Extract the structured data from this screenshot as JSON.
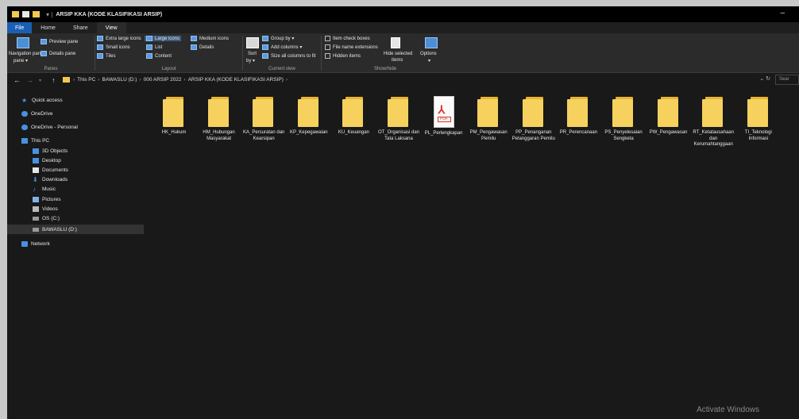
{
  "window": {
    "title": "ARSIP KKA (KODE KLASIFIKASI ARSIP)",
    "minimize_glyph": "–"
  },
  "tabs": [
    {
      "label": "File"
    },
    {
      "label": "Home"
    },
    {
      "label": "Share"
    },
    {
      "label": "View"
    }
  ],
  "ribbon": {
    "panes": {
      "label": "Panes",
      "navigation_pane": "Navigation pane",
      "navigation_pane_dd": "pane ▾",
      "preview_pane": "Preview pane",
      "details_pane": "Details pane"
    },
    "layout": {
      "label": "Layout",
      "extra_large_icons": "Extra large icons",
      "large_icons": "Large icons",
      "medium_icons": "Medium icons",
      "small_icons": "Small icons",
      "list": "List",
      "details": "Details",
      "tiles": "Tiles",
      "content": "Content"
    },
    "current_view": {
      "label": "Current view",
      "sort_by": "Sort",
      "sort_by_2": "by ▾",
      "group_by": "Group by ▾",
      "add_columns": "Add columns ▾",
      "size_all_columns": "Size all columns to fit"
    },
    "show_hide": {
      "label": "Show/hide",
      "item_check_boxes": "Item check boxes",
      "file_name_extensions": "File name extensions",
      "hidden_items": "Hidden items",
      "hide_selected": "Hide selected",
      "hide_selected_2": "items",
      "options": "Options",
      "options_dd": "▾"
    }
  },
  "address_bar": {
    "back": "←",
    "forward": "→",
    "recent": "▾",
    "up": "↑",
    "breadcrumbs": [
      "This PC",
      "BAWASLU (D:)",
      "000 ARSIP 2022",
      "ARSIP KKA (KODE KLASIFIKASI ARSIP)"
    ],
    "separator": "›",
    "refresh": "↻",
    "dropdown": "⌄",
    "search_placeholder": "Sear"
  },
  "nav_pane": {
    "quick_access": "Quick access",
    "onedrive": "OneDrive",
    "onedrive_personal": "OneDrive - Personal",
    "this_pc": "This PC",
    "objects3d": "3D Objects",
    "desktop": "Desktop",
    "documents": "Documents",
    "downloads": "Downloads",
    "music": "Music",
    "pictures": "Pictures",
    "videos": "Videos",
    "os_c": "OS (C:)",
    "bawaslu_d": "BAWASLU (D:)",
    "network": "Network"
  },
  "items": [
    {
      "name": "HK_Hukum",
      "type": "folder"
    },
    {
      "name": "HM_Hubungan Masyarakat",
      "type": "folder"
    },
    {
      "name": "KA_Persuratan dan Kearsipan",
      "type": "folder"
    },
    {
      "name": "KP_Kepegawaian",
      "type": "folder"
    },
    {
      "name": "KU_Keuangan",
      "type": "folder"
    },
    {
      "name": "OT_Organisasi dan Tata Laksana",
      "type": "folder"
    },
    {
      "name": "PL_Perlengkapan",
      "type": "pdf",
      "pdf_tag": "PDF"
    },
    {
      "name": "PM_Pengawasan Pemilu",
      "type": "folder"
    },
    {
      "name": "PP_Penanganan Pelanggaran Pemilu",
      "type": "folder"
    },
    {
      "name": "PR_Perencanaan",
      "type": "folder"
    },
    {
      "name": "PS_Penyelesaian Sengketa",
      "type": "folder"
    },
    {
      "name": "PW_Pengawasan",
      "type": "folder"
    },
    {
      "name": "RT_Ketatausahaan dan Kerumahtanggaan",
      "type": "folder"
    },
    {
      "name": "TI_Teknologi Informasi",
      "type": "folder"
    }
  ],
  "watermark": "Activate Windows"
}
